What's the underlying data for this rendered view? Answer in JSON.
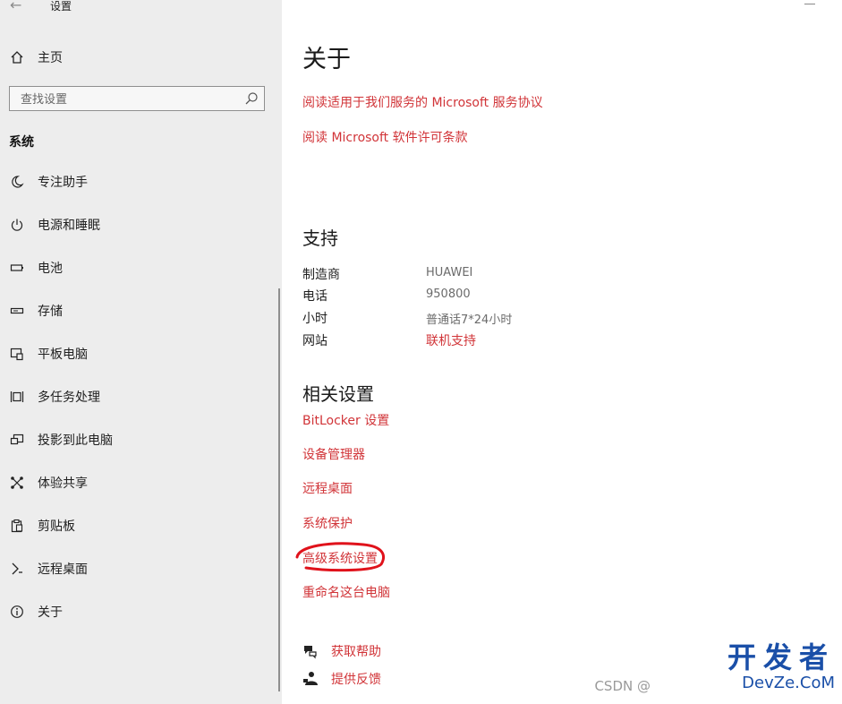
{
  "window": {
    "title": "设置",
    "back_icon": "arrow-left-icon"
  },
  "sidebar": {
    "home": {
      "label": "主页",
      "icon": "home-icon"
    },
    "search": {
      "placeholder": "查找设置",
      "icon": "search-icon"
    },
    "section": "系统",
    "items": [
      {
        "label": "专注助手",
        "icon": "moon-icon"
      },
      {
        "label": "电源和睡眠",
        "icon": "power-icon"
      },
      {
        "label": "电池",
        "icon": "battery-icon"
      },
      {
        "label": "存储",
        "icon": "storage-icon"
      },
      {
        "label": "平板电脑",
        "icon": "tablet-icon"
      },
      {
        "label": "多任务处理",
        "icon": "multitask-icon"
      },
      {
        "label": "投影到此电脑",
        "icon": "project-icon"
      },
      {
        "label": "体验共享",
        "icon": "share-icon"
      },
      {
        "label": "剪贴板",
        "icon": "clipboard-icon"
      },
      {
        "label": "远程桌面",
        "icon": "remote-icon"
      },
      {
        "label": "关于",
        "icon": "info-icon"
      }
    ]
  },
  "main": {
    "title": "关于",
    "agreement_links": [
      "阅读适用于我们服务的 Microsoft 服务协议",
      "阅读 Microsoft 软件许可条款"
    ],
    "support": {
      "heading": "支持",
      "rows": [
        {
          "key": "制造商",
          "value": "HUAWEI"
        },
        {
          "key": "电话",
          "value": "950800"
        },
        {
          "key": "小时",
          "value": "普通话7*24小时"
        },
        {
          "key": "网站",
          "value": "联机支持"
        }
      ]
    },
    "related": {
      "heading": "相关设置",
      "links": [
        "BitLocker 设置",
        "设备管理器",
        "远程桌面",
        "系统保护",
        "高级系统设置",
        "重命名这台电脑"
      ]
    },
    "help": [
      {
        "label": "获取帮助",
        "icon": "help-chat-icon"
      },
      {
        "label": "提供反馈",
        "icon": "feedback-icon"
      }
    ]
  },
  "watermark": {
    "big": "开发者",
    "small": "DevZe.CoM",
    "csdn": "CSDN @"
  },
  "colors": {
    "accent": "#d13438",
    "sidebar_bg": "#ededed",
    "annotation": "#e0121b"
  }
}
